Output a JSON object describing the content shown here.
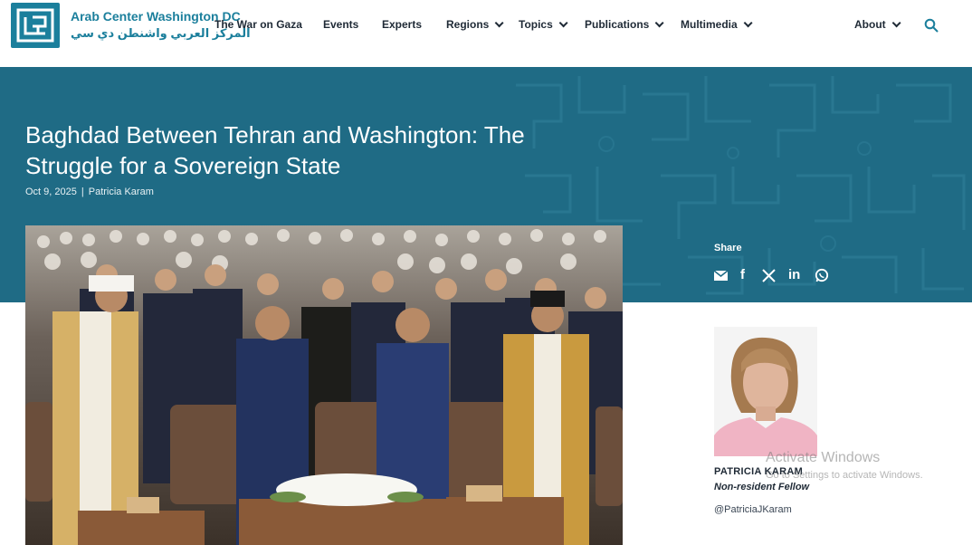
{
  "header": {
    "logo_en": "Arab Center Washington DC",
    "logo_ar": "المركز العربي واشنطن دي سي",
    "nav": [
      {
        "label": "The War on Gaza",
        "dropdown": false
      },
      {
        "label": "Events",
        "dropdown": false
      },
      {
        "label": "Experts",
        "dropdown": false
      },
      {
        "label": "Regions",
        "dropdown": true
      },
      {
        "label": "Topics",
        "dropdown": true
      },
      {
        "label": "Publications",
        "dropdown": true
      },
      {
        "label": "Multimedia",
        "dropdown": true
      },
      {
        "label": "About",
        "dropdown": true
      }
    ],
    "search_icon": "search-icon"
  },
  "article": {
    "title": "Baghdad Between Tehran and Washington: The Struggle for a Sovereign State",
    "date": "Oct 9, 2025",
    "separator": "|",
    "author": "Patricia Karam"
  },
  "share": {
    "label": "Share",
    "icons": [
      "email-icon",
      "facebook-icon",
      "x-icon",
      "linkedin-icon",
      "whatsapp-icon"
    ]
  },
  "author_card": {
    "name": "PATRICIA KARAM",
    "role": "Non-resident Fellow",
    "handle": "@PatriciaJKaram"
  },
  "watermark": {
    "title": "Activate Windows",
    "subtitle": "Go to Settings to activate Windows."
  },
  "colors": {
    "brand": "#1b7f9c",
    "hero": "#1f6b85",
    "nav_text": "#1f2a36"
  }
}
